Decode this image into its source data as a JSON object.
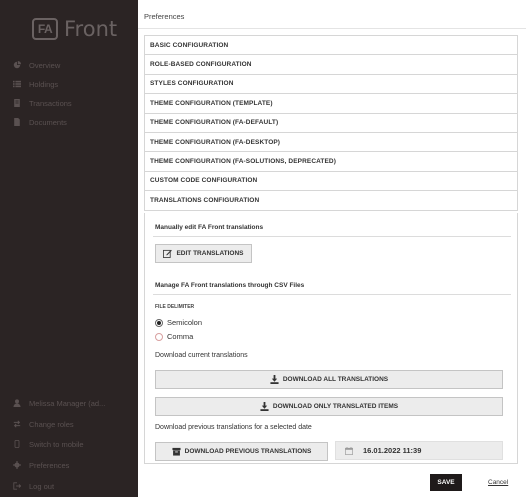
{
  "app": {
    "logo_mark": "FA",
    "logo_text": "Front"
  },
  "sidebar": {
    "top_items": [
      {
        "label": "Overview",
        "icon": "pie-chart-icon"
      },
      {
        "label": "Holdings",
        "icon": "list-icon"
      },
      {
        "label": "Transactions",
        "icon": "receipt-icon"
      },
      {
        "label": "Documents",
        "icon": "document-icon"
      }
    ],
    "bottom_items": [
      {
        "label": "Melissa Manager (ad...",
        "icon": "user-icon"
      },
      {
        "label": "Change roles",
        "icon": "swap-icon"
      },
      {
        "label": "Switch to mobile",
        "icon": "mobile-icon"
      },
      {
        "label": "Preferences",
        "icon": "gear-icon"
      },
      {
        "label": "Log out",
        "icon": "logout-icon"
      }
    ]
  },
  "page": {
    "title": "Preferences"
  },
  "accordion": {
    "items": [
      "BASIC CONFIGURATION",
      "ROLE-BASED CONFIGURATION",
      "STYLES CONFIGURATION",
      "THEME CONFIGURATION (TEMPLATE)",
      "THEME CONFIGURATION (FA-DEFAULT)",
      "THEME CONFIGURATION (FA-DESKTOP)",
      "THEME CONFIGURATION (FA-SOLUTIONS, DEPRECATED)",
      "CUSTOM CODE CONFIGURATION",
      "TRANSLATIONS CONFIGURATION"
    ]
  },
  "translations": {
    "manual_title": "Manually edit FA Front translations",
    "edit_button": "EDIT TRANSLATIONS",
    "csv_title": "Manage FA Front translations through CSV Files",
    "delimiter_label": "FILE DELIMITER",
    "delimiter_options": [
      "Semicolon",
      "Comma"
    ],
    "delimiter_selected": "Semicolon",
    "download_current_label": "Download current translations",
    "download_all_button": "DOWNLOAD ALL TRANSLATIONS",
    "download_translated_button": "DOWNLOAD ONLY TRANSLATED ITEMS",
    "download_previous_label": "Download previous translations for a selected date",
    "download_previous_button": "DOWNLOAD PREVIOUS TRANSLATIONS",
    "date_value": "16.01.2022 11:39"
  },
  "footer": {
    "save_label": "SAVE",
    "cancel_label": "Cancel"
  },
  "colors": {
    "sidebar_bg": "#2b2424",
    "save_bg": "#1f1a1a",
    "button_bg": "#ececec"
  }
}
